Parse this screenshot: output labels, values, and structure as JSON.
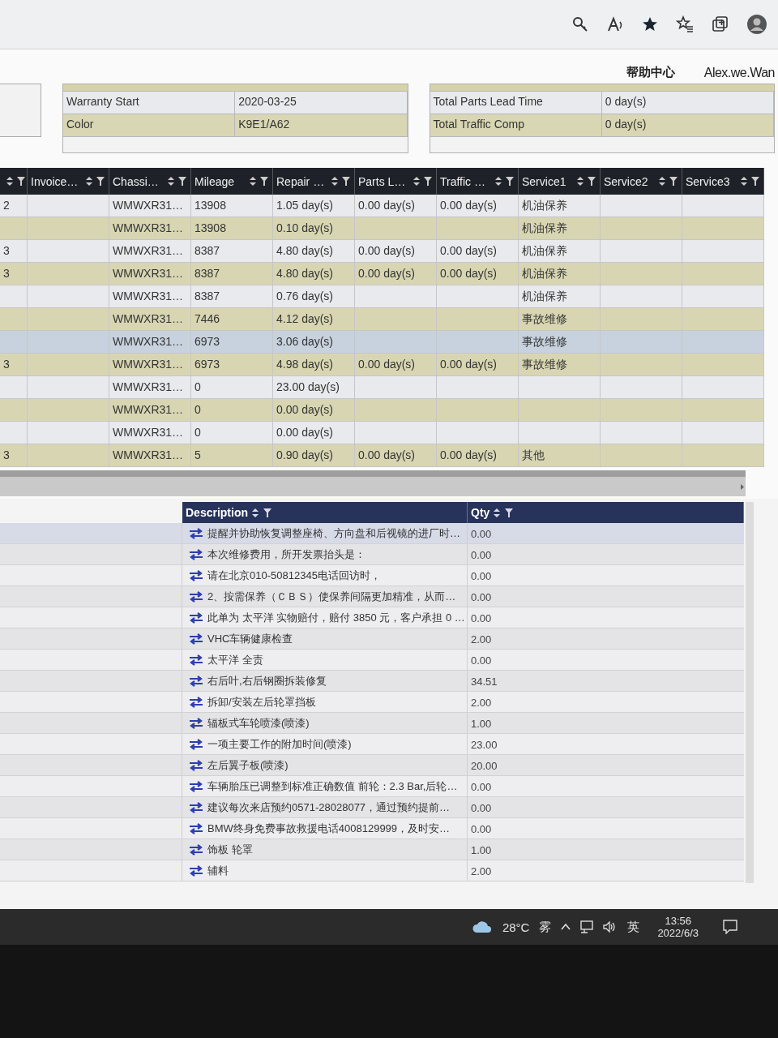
{
  "header": {
    "help_link": "帮助中心",
    "user_name": "Alex.we.Wan"
  },
  "info_panels": [
    {
      "rows": [
        {
          "label": "Warranty Start",
          "value": "2020-03-25"
        },
        {
          "label": "Color",
          "value": "K9E1/A62"
        }
      ]
    },
    {
      "rows": [
        {
          "label": "Total Parts Lead Time",
          "value": "0 day(s)"
        },
        {
          "label": "Total Traffic Comp",
          "value": "0 day(s)"
        }
      ]
    }
  ],
  "grid": {
    "columns": [
      {},
      {
        "label": "Invoice…"
      },
      {
        "label": "Chassi…"
      },
      {
        "label": "Mileage"
      },
      {
        "label": "Repair …"
      },
      {
        "label": "Parts L…"
      },
      {
        "label": "Traffic …"
      },
      {
        "label": "Service1"
      },
      {
        "label": "Service2"
      },
      {
        "label": "Service3"
      }
    ],
    "rows": [
      {
        "selected": false,
        "cells": [
          "2",
          null,
          "WMWXR31…",
          "13908",
          "1.05 day(s)",
          "0.00 day(s)",
          "0.00 day(s)",
          "机油保养",
          null,
          null
        ]
      },
      {
        "selected": false,
        "cells": [
          null,
          null,
          "WMWXR31…",
          "13908",
          "0.10 day(s)",
          null,
          null,
          "机油保养",
          null,
          null
        ]
      },
      {
        "selected": false,
        "cells": [
          "3",
          null,
          "WMWXR31…",
          "8387",
          "4.80 day(s)",
          "0.00 day(s)",
          "0.00 day(s)",
          "机油保养",
          null,
          null
        ]
      },
      {
        "selected": false,
        "cells": [
          "3",
          null,
          "WMWXR31…",
          "8387",
          "4.80 day(s)",
          "0.00 day(s)",
          "0.00 day(s)",
          "机油保养",
          null,
          null
        ]
      },
      {
        "selected": false,
        "cells": [
          null,
          null,
          "WMWXR31…",
          "8387",
          "0.76 day(s)",
          null,
          null,
          "机油保养",
          null,
          null
        ]
      },
      {
        "selected": false,
        "cells": [
          null,
          null,
          "WMWXR31…",
          "7446",
          "4.12 day(s)",
          null,
          null,
          "事故维修",
          null,
          null
        ]
      },
      {
        "selected": true,
        "cells": [
          null,
          null,
          "WMWXR31…",
          "6973",
          "3.06 day(s)",
          null,
          null,
          "事故维修",
          null,
          null
        ]
      },
      {
        "selected": false,
        "cells": [
          "3",
          null,
          "WMWXR31…",
          "6973",
          "4.98 day(s)",
          "0.00 day(s)",
          "0.00 day(s)",
          "事故维修",
          null,
          null
        ]
      },
      {
        "selected": false,
        "cells": [
          null,
          null,
          "WMWXR31…",
          "0",
          "23.00 day(s)",
          null,
          null,
          null,
          null,
          null
        ]
      },
      {
        "selected": false,
        "cells": [
          null,
          null,
          "WMWXR31…",
          "0",
          "0.00 day(s)",
          null,
          null,
          null,
          null,
          null
        ]
      },
      {
        "selected": false,
        "cells": [
          null,
          null,
          "WMWXR31…",
          "0",
          "0.00 day(s)",
          null,
          null,
          null,
          null,
          null
        ]
      },
      {
        "selected": false,
        "cells": [
          "3",
          null,
          "WMWXR31…",
          "5",
          "0.90 day(s)",
          "0.00 day(s)",
          "0.00 day(s)",
          "其他",
          null,
          null
        ]
      }
    ]
  },
  "items_grid": {
    "columns": [
      {
        "label": "Description",
        "filter": true
      },
      {
        "label": "Qty",
        "filter": true
      }
    ],
    "rows": [
      {
        "selected": true,
        "description": "提醒并协助恢复调整座椅、方向盘和后视镜的进厂时…",
        "qty": "0.00"
      },
      {
        "selected": false,
        "description": "本次维修费用，所开发票抬头是：",
        "qty": "0.00"
      },
      {
        "selected": false,
        "description": "请在北京010-50812345电话回访时，",
        "qty": "0.00"
      },
      {
        "selected": false,
        "description": "2、按需保养（ＣＢＳ）使保养间隔更加精准，从而…",
        "qty": "0.00"
      },
      {
        "selected": false,
        "description": "此单为 太平洋 实物赔付，赔付 3850 元，客户承担 0 …",
        "qty": "0.00"
      },
      {
        "selected": false,
        "description": "VHC车辆健康检查",
        "qty": "2.00"
      },
      {
        "selected": false,
        "description": "太平洋 全责",
        "qty": "0.00"
      },
      {
        "selected": false,
        "description": "右后叶,右后钢圈拆装修复",
        "qty": "34.51"
      },
      {
        "selected": false,
        "description": "拆卸/安装左后轮罩挡板",
        "qty": "2.00"
      },
      {
        "selected": false,
        "description": "辐板式车轮喷漆(喷漆)",
        "qty": "1.00"
      },
      {
        "selected": false,
        "description": "一项主要工作的附加时间(喷漆)",
        "qty": "23.00"
      },
      {
        "selected": false,
        "description": "左后翼子板(喷漆)",
        "qty": "20.00"
      },
      {
        "selected": false,
        "description": "车辆胎压已调整到标准正确数值 前轮：2.3 Bar,后轮…",
        "qty": "0.00"
      },
      {
        "selected": false,
        "description": "建议每次来店预约0571-28028077，通过预约提前…",
        "qty": "0.00"
      },
      {
        "selected": false,
        "description": "BMW终身免费事故救援电话4008129999，及时安…",
        "qty": "0.00"
      },
      {
        "selected": false,
        "description": "饰板 轮罩",
        "qty": "1.00"
      },
      {
        "selected": false,
        "description": "辅料",
        "qty": "2.00"
      }
    ]
  },
  "taskbar": {
    "temperature": "28°C",
    "weather": "雾",
    "input_method": "英",
    "time": "13:56",
    "date": "2022/6/3"
  }
}
